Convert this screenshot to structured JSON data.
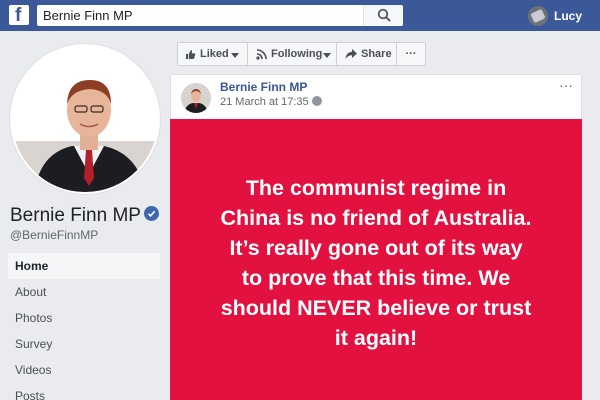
{
  "header": {
    "logo_letter": "f",
    "search_value": "Bernie Finn MP",
    "user_name": "Lucy"
  },
  "page": {
    "name": "Bernie Finn MP",
    "handle": "@BernieFinnMP"
  },
  "nav": {
    "items": [
      "Home",
      "About",
      "Photos",
      "Survey",
      "Videos",
      "Posts"
    ],
    "active": "Home"
  },
  "actions": {
    "liked": "Liked",
    "following": "Following",
    "share": "Share",
    "more": "···"
  },
  "post": {
    "author": "Bernie Finn MP",
    "time": "21 March at 17:35",
    "more": "···",
    "image_text": "The communist regime in\nChina is no friend of Australia.\nIt’s really gone out of its way\nto prove that this time. We\nshould NEVER believe or trust\nit again!"
  },
  "colors": {
    "brand": "#3b5998",
    "post_image_bg": "#e2113f",
    "verified": "#4267b2"
  }
}
